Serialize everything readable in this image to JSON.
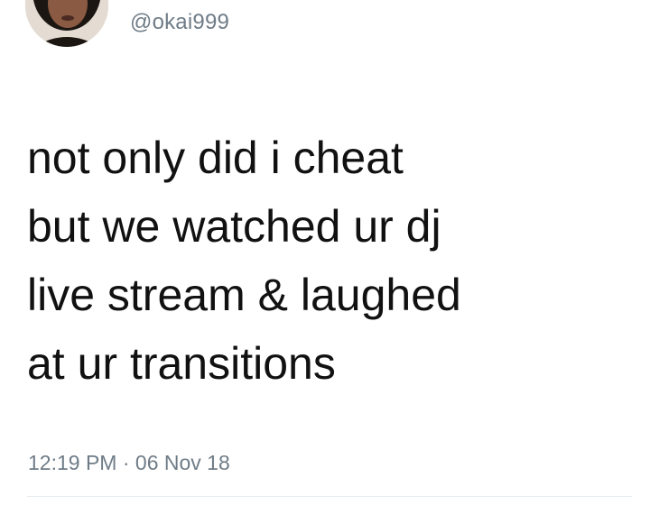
{
  "tweet": {
    "author": {
      "handle": "@okai999",
      "avatar_icon": "profile-photo"
    },
    "text_lines": [
      "not only did i cheat",
      "but we watched ur dj",
      "live stream & laughed",
      "at ur transitions"
    ],
    "time": "12:19 PM",
    "separator": "·",
    "date": "06 Nov 18"
  },
  "colors": {
    "text": "#111111",
    "secondary": "#6f7c87",
    "divider": "#e6ecf0"
  }
}
